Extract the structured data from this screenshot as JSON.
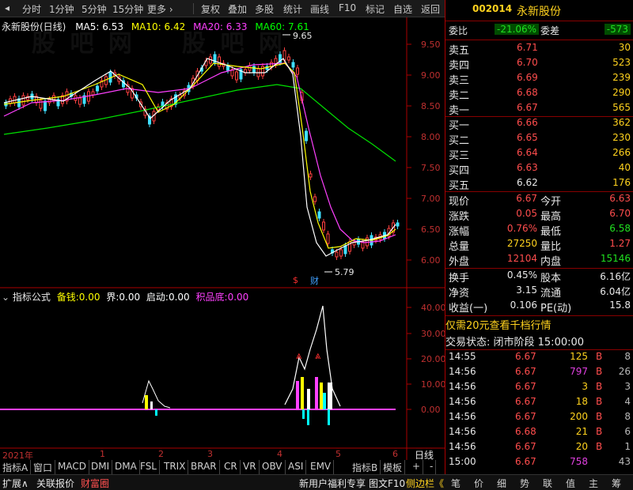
{
  "toolbar": {
    "items": [
      "分时",
      "1分钟",
      "5分钟",
      "15分钟",
      "更多",
      "复权",
      "叠加",
      "多股",
      "统计",
      "画线",
      "F10",
      "标记",
      "自选",
      "返回"
    ]
  },
  "stock": {
    "code": "002014",
    "name": "永新股份",
    "title": "永新股份(日线)"
  },
  "ma": {
    "ma5": "MA5: 6.53",
    "ma10": "MA10: 6.42",
    "ma20": "MA20: 6.33",
    "ma60": "MA60: 7.61",
    "colors": {
      "ma5": "#ffffff",
      "ma10": "#ffff00",
      "ma20": "#ff40ff",
      "ma60": "#00ff00"
    }
  },
  "price_axis": [
    "9.50",
    "9.00",
    "8.50",
    "8.00",
    "7.50",
    "7.00",
    "6.50",
    "6.00"
  ],
  "annotations": {
    "high": "9.65",
    "low": "5.79",
    "s_mark": "$",
    "cai_mark": "财"
  },
  "indicator": {
    "name": "指标公式",
    "items": [
      {
        "label": "备钱:",
        "value": "0.00",
        "color": "#ffff00"
      },
      {
        "label": "界:",
        "value": "0.00",
        "color": "#ffffff"
      },
      {
        "label": "启动:",
        "value": "0.00",
        "color": "#ffffff"
      },
      {
        "label": "积品底:",
        "value": "0.00",
        "color": "#ff40ff"
      }
    ],
    "axis": [
      "40.00",
      "30.00",
      "20.00",
      "10.00",
      "0.00"
    ]
  },
  "time_axis": {
    "year": "2021年",
    "months": [
      "1",
      "2",
      "3",
      "4",
      "5",
      "6"
    ],
    "period": "日线"
  },
  "bottom_tabs": [
    "指标A",
    "窗口",
    "MACD",
    "DMI",
    "DMA",
    "FSL",
    "TRIX",
    "BRAR",
    "CR",
    "VR",
    "OBV",
    "ASI",
    "EMV",
    "指标B",
    "模板",
    "+",
    "-"
  ],
  "status_bar": {
    "left1": "扩展∧",
    "left2": "关联报价",
    "left3": "财富圈",
    "right1": "新用户福利专享",
    "right2": "图文F10",
    "right3": "侧边栏《"
  },
  "quote": {
    "weibi_label": "委比",
    "weibi": "-21.06%",
    "weicha_label": "委差",
    "weicha": "-573",
    "asks": [
      {
        "label": "卖五",
        "price": "6.71",
        "vol": "30"
      },
      {
        "label": "卖四",
        "price": "6.70",
        "vol": "523"
      },
      {
        "label": "卖三",
        "price": "6.69",
        "vol": "239"
      },
      {
        "label": "卖二",
        "price": "6.68",
        "vol": "290"
      },
      {
        "label": "卖一",
        "price": "6.67",
        "vol": "565"
      }
    ],
    "bids": [
      {
        "label": "买一",
        "price": "6.66",
        "vol": "362"
      },
      {
        "label": "买二",
        "price": "6.65",
        "vol": "230"
      },
      {
        "label": "买三",
        "price": "6.64",
        "vol": "266"
      },
      {
        "label": "买四",
        "price": "6.63",
        "vol": "40"
      },
      {
        "label": "买五",
        "price": "6.62",
        "vol": "176"
      }
    ],
    "stats": [
      {
        "l1": "现价",
        "v1": "6.67",
        "c1": "red",
        "l2": "今开",
        "v2": "6.63",
        "c2": "red"
      },
      {
        "l1": "涨跌",
        "v1": "0.05",
        "c1": "red",
        "l2": "最高",
        "v2": "6.70",
        "c2": "red"
      },
      {
        "l1": "涨幅",
        "v1": "0.76%",
        "c1": "red",
        "l2": "最低",
        "v2": "6.58",
        "c2": "green"
      },
      {
        "l1": "总量",
        "v1": "27250",
        "c1": "yellow",
        "l2": "量比",
        "v2": "1.27",
        "c2": "red"
      },
      {
        "l1": "外盘",
        "v1": "12104",
        "c1": "red",
        "l2": "内盘",
        "v2": "15146",
        "c2": "green"
      }
    ],
    "stats2": [
      {
        "l1": "换手",
        "v1": "0.45%",
        "l2": "股本",
        "v2": "6.16亿"
      },
      {
        "l1": "净资",
        "v1": "3.15",
        "l2": "流通",
        "v2": "6.04亿"
      },
      {
        "l1": "收益(一)",
        "v1": "0.106",
        "l2": "PE(动)",
        "v2": "15.8"
      }
    ],
    "promo": "仅需20元查看千档行情",
    "trade_status": "交易状态: 闭市阶段 15:00:00",
    "ticks": [
      {
        "time": "14:55",
        "price": "6.67",
        "vol": "125",
        "vcolor": "yellow",
        "bs": "B",
        "n": "8"
      },
      {
        "time": "14:56",
        "price": "6.67",
        "vol": "797",
        "vcolor": "magenta",
        "bs": "B",
        "n": "26"
      },
      {
        "time": "14:56",
        "price": "6.67",
        "vol": "3",
        "vcolor": "yellow",
        "bs": "B",
        "n": "3"
      },
      {
        "time": "14:56",
        "price": "6.67",
        "vol": "18",
        "vcolor": "yellow",
        "bs": "B",
        "n": "4"
      },
      {
        "time": "14:56",
        "price": "6.67",
        "vol": "200",
        "vcolor": "yellow",
        "bs": "B",
        "n": "8"
      },
      {
        "time": "14:56",
        "price": "6.68",
        "vol": "21",
        "vcolor": "yellow",
        "bs": "B",
        "n": "6"
      },
      {
        "time": "14:56",
        "price": "6.67",
        "vol": "20",
        "vcolor": "yellow",
        "bs": "B",
        "n": "1"
      },
      {
        "time": "15:00",
        "price": "6.67",
        "vol": "758",
        "vcolor": "magenta",
        "bs": "",
        "n": "43"
      }
    ],
    "bottom_tabs": [
      "笔",
      "价",
      "细",
      "势",
      "联",
      "值",
      "主",
      "筹"
    ]
  }
}
